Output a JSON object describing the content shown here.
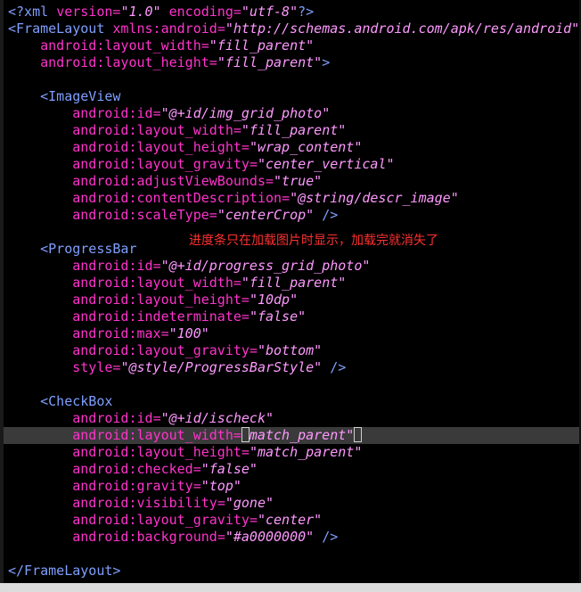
{
  "editor": {
    "lines": [
      [
        [
          "pi",
          "<?xml "
        ],
        [
          "pi-attr",
          "version"
        ],
        [
          "eq",
          "="
        ],
        [
          "val",
          "\"1.0\""
        ],
        [
          "pi",
          " "
        ],
        [
          "pi-attr",
          "encoding"
        ],
        [
          "eq",
          "="
        ],
        [
          "val",
          "\"utf-8\""
        ],
        [
          "pi",
          "?>"
        ]
      ],
      [
        [
          "tag",
          "<FrameLayout "
        ],
        [
          "attr",
          "xmlns:android"
        ],
        [
          "eq",
          "="
        ],
        [
          "val",
          "\"http://schemas.android.com/apk/res/android\""
        ]
      ],
      [
        [
          "tag",
          "    "
        ],
        [
          "attr",
          "android:layout_width"
        ],
        [
          "eq",
          "="
        ],
        [
          "val",
          "\"fill_parent\""
        ]
      ],
      [
        [
          "tag",
          "    "
        ],
        [
          "attr",
          "android:layout_height"
        ],
        [
          "eq",
          "="
        ],
        [
          "val",
          "\"fill_parent\""
        ],
        [
          "tag",
          ">"
        ]
      ],
      [],
      [
        [
          "tag",
          "    <ImageView"
        ]
      ],
      [
        [
          "tag",
          "        "
        ],
        [
          "attr",
          "android:id"
        ],
        [
          "eq",
          "="
        ],
        [
          "val",
          "\"@+id/img_grid_photo\""
        ]
      ],
      [
        [
          "tag",
          "        "
        ],
        [
          "attr",
          "android:layout_width"
        ],
        [
          "eq",
          "="
        ],
        [
          "val",
          "\"fill_parent\""
        ]
      ],
      [
        [
          "tag",
          "        "
        ],
        [
          "attr",
          "android:layout_height"
        ],
        [
          "eq",
          "="
        ],
        [
          "val",
          "\"wrap_content\""
        ]
      ],
      [
        [
          "tag",
          "        "
        ],
        [
          "attr",
          "android:layout_gravity"
        ],
        [
          "eq",
          "="
        ],
        [
          "val",
          "\"center_vertical\""
        ]
      ],
      [
        [
          "tag",
          "        "
        ],
        [
          "attr",
          "android:adjustViewBounds"
        ],
        [
          "eq",
          "="
        ],
        [
          "val",
          "\"true\""
        ]
      ],
      [
        [
          "tag",
          "        "
        ],
        [
          "attr",
          "android:contentDescription"
        ],
        [
          "eq",
          "="
        ],
        [
          "val",
          "\"@string/descr_image\""
        ]
      ],
      [
        [
          "tag",
          "        "
        ],
        [
          "attr",
          "android:scaleType"
        ],
        [
          "eq",
          "="
        ],
        [
          "val",
          "\"centerCrop\""
        ],
        [
          "tag",
          " />"
        ]
      ],
      [],
      [
        [
          "tag",
          "    <ProgressBar"
        ]
      ],
      [
        [
          "tag",
          "        "
        ],
        [
          "attr",
          "android:id"
        ],
        [
          "eq",
          "="
        ],
        [
          "val",
          "\"@+id/progress_grid_photo\""
        ]
      ],
      [
        [
          "tag",
          "        "
        ],
        [
          "attr",
          "android:layout_width"
        ],
        [
          "eq",
          "="
        ],
        [
          "val",
          "\"fill_parent\""
        ]
      ],
      [
        [
          "tag",
          "        "
        ],
        [
          "attr",
          "android:layout_height"
        ],
        [
          "eq",
          "="
        ],
        [
          "val",
          "\"10dp\""
        ]
      ],
      [
        [
          "tag",
          "        "
        ],
        [
          "attr",
          "android:indeterminate"
        ],
        [
          "eq",
          "="
        ],
        [
          "val",
          "\"false\""
        ]
      ],
      [
        [
          "tag",
          "        "
        ],
        [
          "attr",
          "android:max"
        ],
        [
          "eq",
          "="
        ],
        [
          "val",
          "\"100\""
        ]
      ],
      [
        [
          "tag",
          "        "
        ],
        [
          "attr",
          "android:layout_gravity"
        ],
        [
          "eq",
          "="
        ],
        [
          "val",
          "\"bottom\""
        ]
      ],
      [
        [
          "tag",
          "        "
        ],
        [
          "attr",
          "style"
        ],
        [
          "eq",
          "="
        ],
        [
          "val",
          "\"@style/ProgressBarStyle\""
        ],
        [
          "tag",
          " />"
        ]
      ],
      [],
      [
        [
          "tag",
          "    <CheckBox"
        ]
      ],
      [
        [
          "tag",
          "        "
        ],
        [
          "attr",
          "android:id"
        ],
        [
          "eq",
          "="
        ],
        [
          "val",
          "\"@+id/ischeck\""
        ]
      ],
      [
        [
          "tag",
          "        "
        ],
        [
          "attr",
          "android:layout_width"
        ],
        [
          "eq",
          "="
        ],
        [
          "caret",
          ""
        ],
        [
          "val",
          "match_parent\""
        ],
        [
          "caret",
          ""
        ]
      ],
      [
        [
          "tag",
          "        "
        ],
        [
          "attr",
          "android:layout_height"
        ],
        [
          "eq",
          "="
        ],
        [
          "val",
          "\"match_parent\""
        ]
      ],
      [
        [
          "tag",
          "        "
        ],
        [
          "attr",
          "android:checked"
        ],
        [
          "eq",
          "="
        ],
        [
          "val",
          "\"false\""
        ]
      ],
      [
        [
          "tag",
          "        "
        ],
        [
          "attr",
          "android:gravity"
        ],
        [
          "eq",
          "="
        ],
        [
          "val",
          "\"top\""
        ]
      ],
      [
        [
          "tag",
          "        "
        ],
        [
          "attr",
          "android:visibility"
        ],
        [
          "eq",
          "="
        ],
        [
          "val",
          "\"gone\""
        ]
      ],
      [
        [
          "tag",
          "        "
        ],
        [
          "attr",
          "android:layout_gravity"
        ],
        [
          "eq",
          "="
        ],
        [
          "val",
          "\"center\""
        ]
      ],
      [
        [
          "tag",
          "        "
        ],
        [
          "attr",
          "android:background"
        ],
        [
          "eq",
          "="
        ],
        [
          "val",
          "\"#a0000000\""
        ],
        [
          "tag",
          " />"
        ]
      ],
      [],
      [
        [
          "tag",
          "</FrameLayout>"
        ]
      ]
    ],
    "note": "进度条只在加载图片时显示，加载完就消失了"
  },
  "colors": {
    "background": "#000000",
    "tag": "#7f9fff",
    "attribute": "#ff33cc",
    "value": "#ff99ff",
    "annotation": "#ff3030"
  }
}
